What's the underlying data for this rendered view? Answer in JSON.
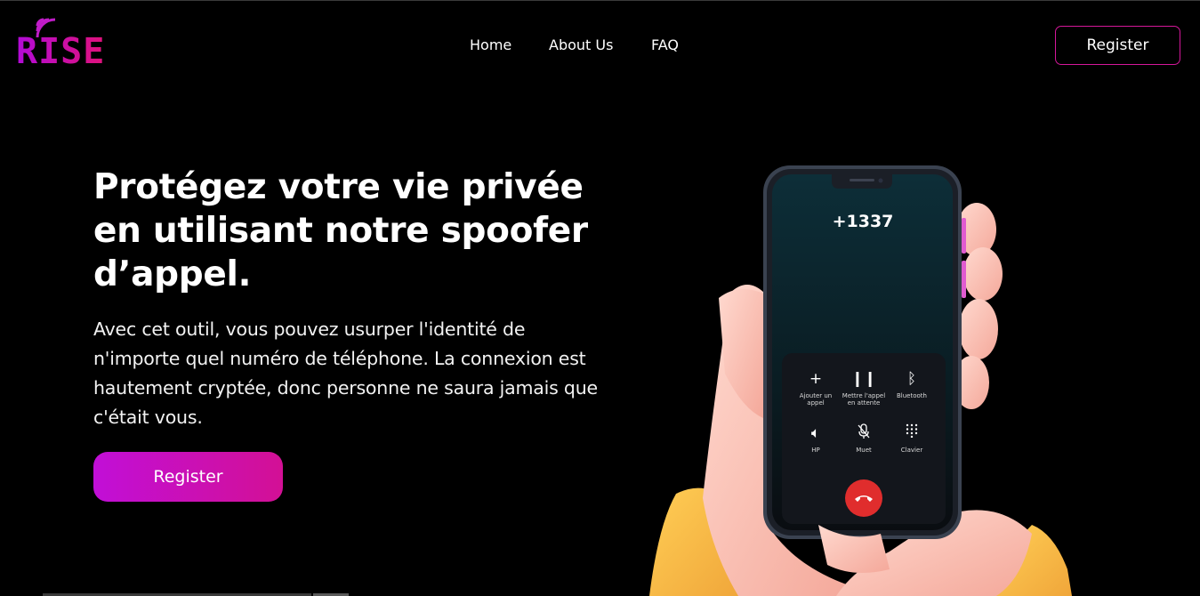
{
  "logo": {
    "text": "RISE",
    "icon": "signal-icon",
    "colors": [
      "#b10bd8",
      "#e0127a"
    ]
  },
  "nav": {
    "items": [
      "Home",
      "About Us",
      "FAQ"
    ],
    "register_label": "Register"
  },
  "hero": {
    "title": "Protégez votre vie privée en utilisant notre spoofer d’appel.",
    "description": "Avec cet outil, vous pouvez usurper l'identité de n'importe quel numéro de téléphone. La connexion est hautement cryptée, donc personne ne saura jamais que c'était vous.",
    "cta_label": "Register"
  },
  "phone": {
    "number": "+1337",
    "controls": [
      {
        "icon": "plus-icon",
        "label": "Ajouter un appel"
      },
      {
        "icon": "pause-icon",
        "label": "Mettre l'appel en attente"
      },
      {
        "icon": "bluetooth-icon",
        "label": "Bluetooth"
      },
      {
        "icon": "speaker-icon",
        "label": "HP"
      },
      {
        "icon": "mic-off-icon",
        "label": "Muet"
      },
      {
        "icon": "keypad-icon",
        "label": "Clavier"
      }
    ],
    "hangup_icon": "hangup-icon"
  },
  "colors": {
    "accent": "#c10fd7",
    "accent2": "#d31095",
    "background": "#000000",
    "hangup": "#e02d2d"
  }
}
